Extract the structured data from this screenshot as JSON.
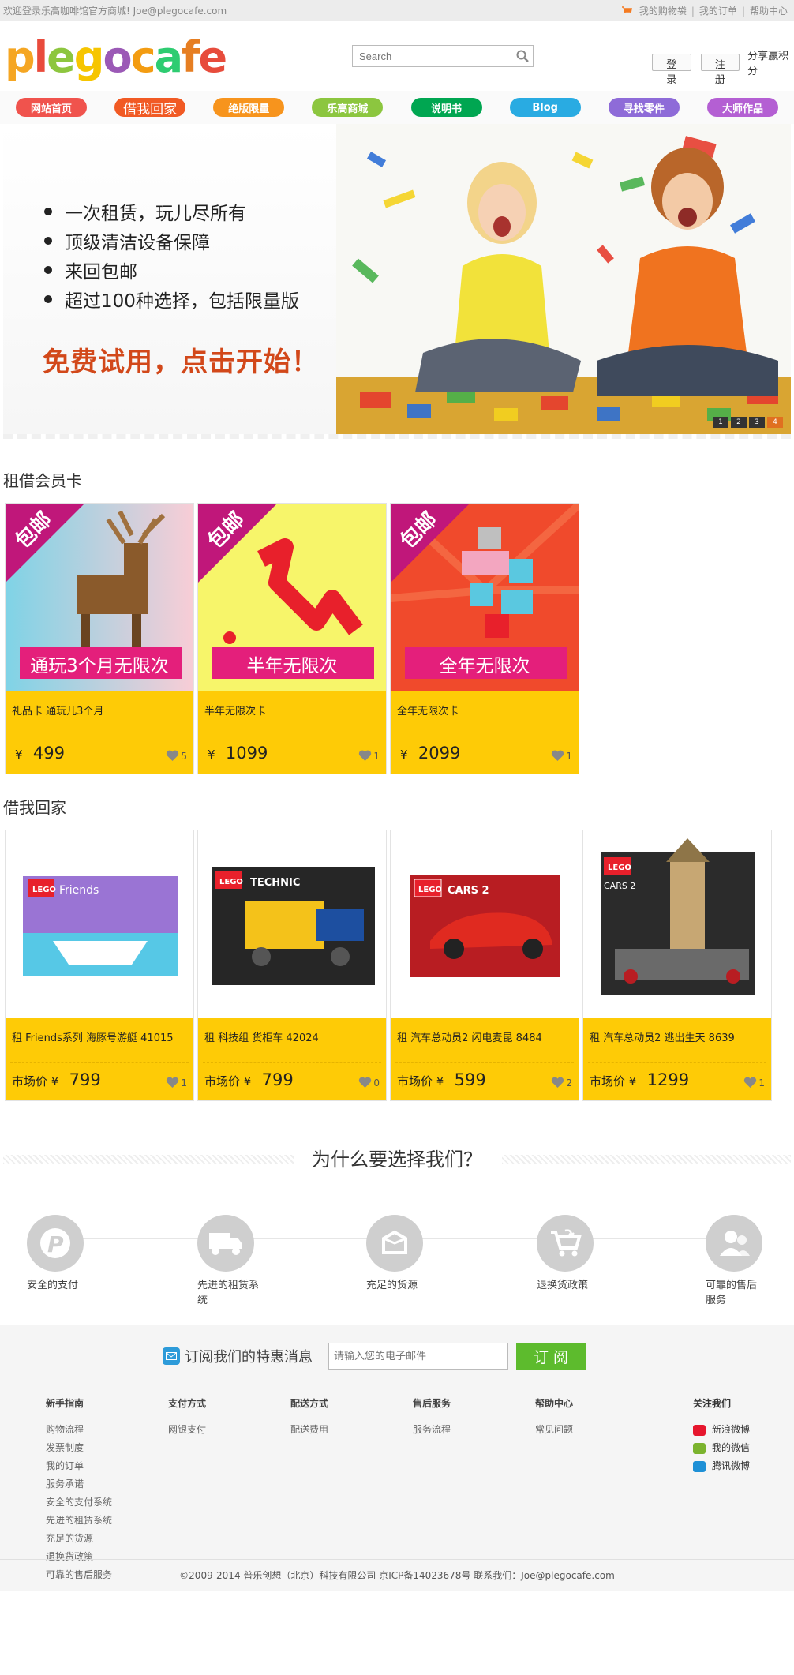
{
  "topbar": {
    "welcome": "欢迎登录乐高咖啡馆官方商城! Joe@plegocafe.com",
    "links": [
      "我的购物袋",
      "我的订单",
      "帮助中心"
    ]
  },
  "header": {
    "logo_text": "plegocafe",
    "search_placeholder": "Search",
    "login": "登录",
    "register": "注册",
    "share": "分享赢积分"
  },
  "nav": [
    {
      "label": "网站首页",
      "color": "#f0534d"
    },
    {
      "label": "借我回家",
      "color": "#f15a24"
    },
    {
      "label": "绝版限量",
      "color": "#f7941d"
    },
    {
      "label": "乐高商城",
      "color": "#8cc63f"
    },
    {
      "label": "说明书",
      "color": "#00a651"
    },
    {
      "label": "Blog",
      "color": "#29abe2"
    },
    {
      "label": "寻找零件",
      "color": "#8e6bd8"
    },
    {
      "label": "大师作品",
      "color": "#b45fd3"
    }
  ],
  "banner": {
    "bullets": [
      "一次租赁，玩儿尽所有",
      "顶级清洁设备保障",
      "来回包邮",
      "超过100种选择，包括限量版"
    ],
    "promo": "免费试用，点击开始！",
    "dots": [
      "1",
      "2",
      "3",
      "4"
    ]
  },
  "membership": {
    "title": "租借会员卡",
    "cards": [
      {
        "ribbon": "包邮",
        "banner": "通玩3个月无限次",
        "name": "礼品卡 通玩儿3个月",
        "currency": "¥",
        "price": "499",
        "likes": "5"
      },
      {
        "ribbon": "包邮",
        "banner": "半年无限次",
        "name": "半年无限次卡",
        "currency": "¥",
        "price": "1099",
        "likes": "1"
      },
      {
        "ribbon": "包邮",
        "banner": "全年无限次",
        "name": "全年无限次卡",
        "currency": "¥",
        "price": "2099",
        "likes": "1"
      }
    ]
  },
  "rentals": {
    "title": "借我回家",
    "cards": [
      {
        "brand": "LEGO",
        "series": "Friends",
        "name": "租 Friends系列 海豚号游艇 41015",
        "prefix": "市场价 ¥",
        "price": "799",
        "likes": "1"
      },
      {
        "brand": "LEGO",
        "series": "TECHNIC",
        "name": "租 科技组 货柜车 42024",
        "prefix": "市场价 ¥",
        "price": "799",
        "likes": "0"
      },
      {
        "brand": "LEGO",
        "series": "CARS 2",
        "name": "租 汽车总动员2 闪电麦昆 8484",
        "prefix": "市场价 ¥",
        "price": "599",
        "likes": "2"
      },
      {
        "brand": "LEGO",
        "series": "CARS 2",
        "name": "租 汽车总动员2 逃出生天 8639",
        "prefix": "市场价 ¥",
        "price": "1299",
        "likes": "1"
      }
    ]
  },
  "why": {
    "title": "为什么要选择我们？",
    "features": [
      {
        "label": "安全的支付",
        "icon": "payment-icon"
      },
      {
        "label": "先进的租赁系统",
        "icon": "truck-icon"
      },
      {
        "label": "充足的货源",
        "icon": "box-icon"
      },
      {
        "label": "退换货政策",
        "icon": "cart-return-icon"
      },
      {
        "label": "可靠的售后服务",
        "icon": "support-icon"
      }
    ]
  },
  "subscribe": {
    "text": "订阅我们的特惠消息",
    "placeholder": "请输入您的电子邮件",
    "button": "订 阅"
  },
  "footer": {
    "columns": [
      {
        "title": "新手指南",
        "items": [
          "购物流程",
          "发票制度",
          "我的订单",
          "服务承诺",
          "安全的支付系统",
          "先进的租赁系统",
          "充足的货源",
          "退换货政策",
          "可靠的售后服务"
        ]
      },
      {
        "title": "支付方式",
        "items": [
          "网银支付"
        ]
      },
      {
        "title": "配送方式",
        "items": [
          "配送费用"
        ]
      },
      {
        "title": "售后服务",
        "items": [
          "服务流程"
        ]
      },
      {
        "title": "帮助中心",
        "items": [
          "常见问题"
        ]
      }
    ],
    "follow": {
      "title": "关注我们",
      "items": [
        {
          "label": "新浪微博",
          "color": "#e6162d"
        },
        {
          "label": "我的微信",
          "color": "#7bb32e"
        },
        {
          "label": "腾讯微博",
          "color": "#1e90d6"
        }
      ]
    },
    "copyright": "©2009-2014 普乐创想（北京）科技有限公司 京ICP备14023678号 联系我们：Joe@plegocafe.com"
  }
}
